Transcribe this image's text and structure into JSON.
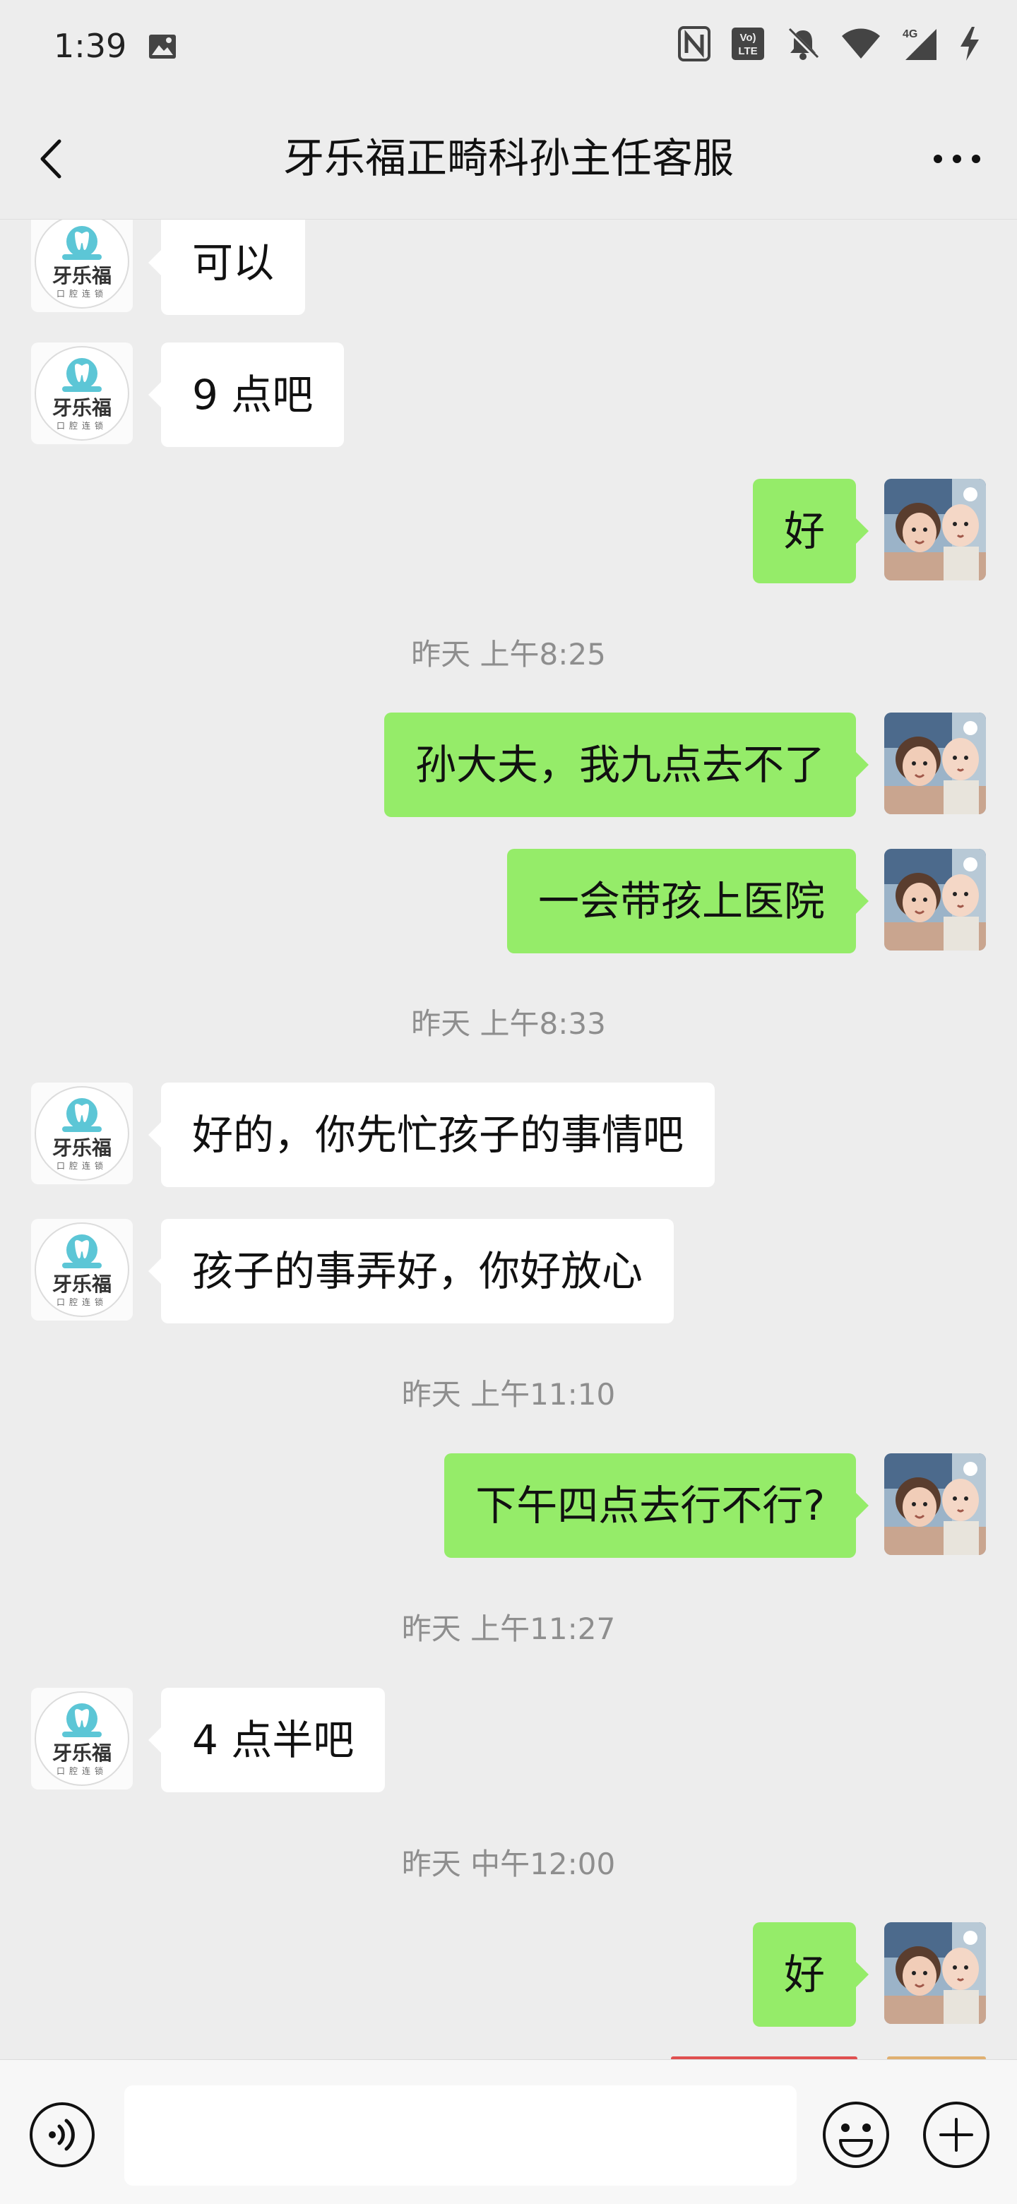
{
  "status_bar": {
    "time": "1:39",
    "icons": [
      "image-icon",
      "nfc-icon",
      "volte-icon",
      "bell-off-icon",
      "wifi-icon",
      "signal-4g-icon",
      "charging-icon"
    ],
    "network_label": "4G",
    "volte_label_top": "Vo)",
    "volte_label_bottom": "LTE"
  },
  "nav": {
    "title": "牙乐福正畸科孙主任客服",
    "back_icon": "chevron-left-icon",
    "more_icon": "more-horizontal-icon"
  },
  "contact_logo": {
    "brand": "牙乐福",
    "tagline": "口腔连锁",
    "accent": "#5cc6d6"
  },
  "messages": [
    {
      "side": "left",
      "text": "可以"
    },
    {
      "side": "left",
      "text": "9 点吧"
    },
    {
      "side": "right",
      "text": "好"
    },
    {
      "timestamp": "昨天 上午8:25"
    },
    {
      "side": "right",
      "text": "孙大夫，我九点去不了"
    },
    {
      "side": "right",
      "text": "一会带孩上医院"
    },
    {
      "timestamp": "昨天 上午8:33"
    },
    {
      "side": "left",
      "text": "好的，你先忙孩子的事情吧"
    },
    {
      "side": "left",
      "text": "孩子的事弄好，你好放心"
    },
    {
      "timestamp": "昨天 上午11:10"
    },
    {
      "side": "right",
      "text": "下午四点去行不行?"
    },
    {
      "timestamp": "昨天 上午11:27"
    },
    {
      "side": "left",
      "text": "4 点半吧"
    },
    {
      "timestamp": "昨天 中午12:00"
    },
    {
      "side": "right",
      "text": "好"
    }
  ],
  "input_bar": {
    "voice_icon": "voice-icon",
    "input_value": "",
    "emoji_icon": "emoji-icon",
    "plus_icon": "plus-circle-icon"
  },
  "colors": {
    "background": "#ededed",
    "self_bubble": "#95ec69",
    "other_bubble": "#ffffff",
    "timestamp_text": "#8e8e8e"
  }
}
